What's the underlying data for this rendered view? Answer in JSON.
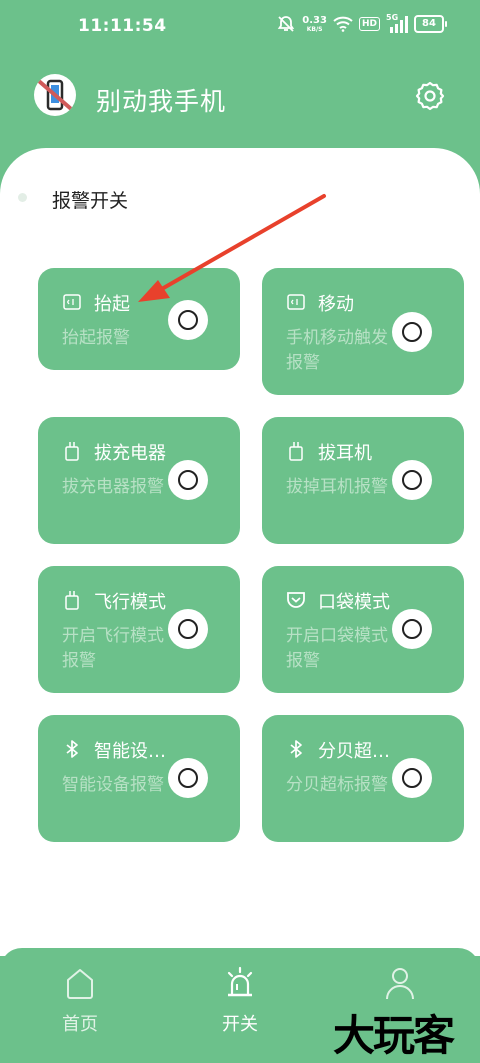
{
  "status": {
    "time": "11:11:54",
    "speed_value": "0.33",
    "speed_unit": "KB/S",
    "hd": "HD",
    "signal": "5G",
    "battery": "84"
  },
  "header": {
    "title": "别动我手机"
  },
  "section": {
    "title": "报警开关"
  },
  "cards": [
    {
      "title": "抬起",
      "desc": "抬起报警",
      "icon": "phone-lift-icon"
    },
    {
      "title": "移动",
      "desc": "手机移动触发报警",
      "icon": "phone-move-icon"
    },
    {
      "title": "拔充电器",
      "desc": "拔充电器报警",
      "icon": "charger-plug-icon"
    },
    {
      "title": "拔耳机",
      "desc": "拔掉耳机报警",
      "icon": "headphone-plug-icon"
    },
    {
      "title": "飞行模式",
      "desc": "开启飞行模式报警",
      "icon": "airplane-plug-icon"
    },
    {
      "title": "口袋模式",
      "desc": "开启口袋模式报警",
      "icon": "pocket-icon"
    },
    {
      "title": "智能设…",
      "desc": "智能设备报警",
      "icon": "bluetooth-icon"
    },
    {
      "title": "分贝超…",
      "desc": "分贝超标报警",
      "icon": "bluetooth-icon"
    }
  ],
  "nav": [
    {
      "label": "首页",
      "icon": "home-icon"
    },
    {
      "label": "开关",
      "icon": "alarm-light-icon",
      "active": true
    },
    {
      "label": "",
      "icon": "user-icon"
    }
  ],
  "watermark": "大玩客",
  "colors": {
    "brand": "#6cc18b",
    "card_desc": "#b7e1c5",
    "arrow": "#e8412c"
  }
}
